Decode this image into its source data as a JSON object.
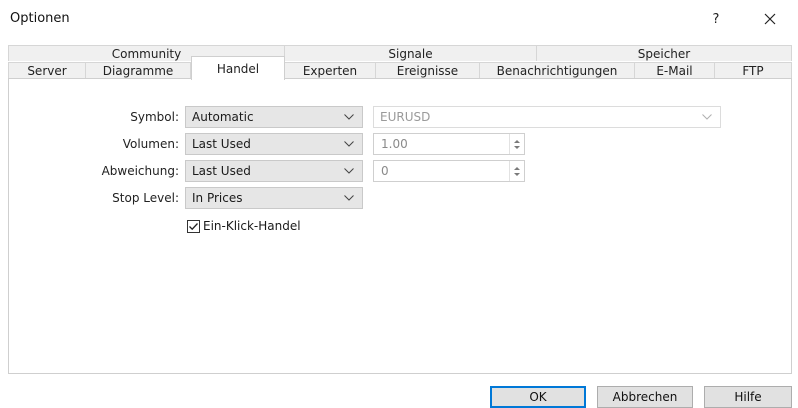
{
  "window": {
    "title": "Optionen",
    "help_label": "?",
    "close_label": "✕"
  },
  "tabs": {
    "row1": [
      "Community",
      "Signale",
      "Speicher"
    ],
    "row2": [
      "Server",
      "Diagramme",
      "Handel",
      "Experten",
      "Ereignisse",
      "Benachrichtigungen",
      "E-Mail",
      "FTP"
    ],
    "active": "Handel"
  },
  "form": {
    "symbol": {
      "label": "Symbol:",
      "mode": "Automatic",
      "value": "EURUSD"
    },
    "volume": {
      "label": "Volumen:",
      "mode": "Last Used",
      "value": "1.00"
    },
    "deviation": {
      "label": "Abweichung:",
      "mode": "Last Used",
      "value": "0"
    },
    "stop_level": {
      "label": "Stop Level:",
      "mode": "In Prices"
    },
    "one_click": {
      "label": "Ein-Klick-Handel",
      "checked": true
    }
  },
  "buttons": {
    "ok": "OK",
    "cancel": "Abbrechen",
    "help": "Hilfe"
  }
}
